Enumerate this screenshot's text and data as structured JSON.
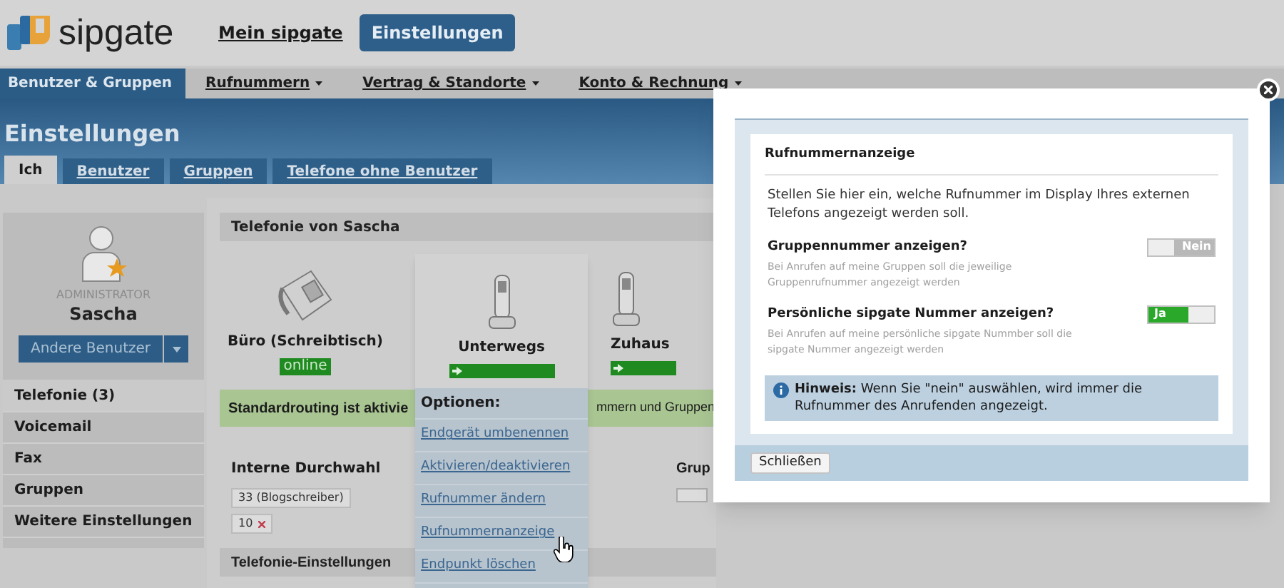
{
  "header": {
    "logo": "sipgate",
    "nav": [
      {
        "label": "Mein sipgate",
        "selected": false
      },
      {
        "label": "Einstellungen",
        "selected": true
      }
    ]
  },
  "menu": [
    {
      "label": "Benutzer & Gruppen",
      "selected": true
    },
    {
      "label": "Rufnummern",
      "selected": false
    },
    {
      "label": "Vertrag & Standorte",
      "selected": false
    },
    {
      "label": "Konto & Rechnung",
      "selected": false
    }
  ],
  "page_title": "Einstellungen",
  "tabs": [
    {
      "label": "Ich",
      "selected": true
    },
    {
      "label": "Benutzer",
      "selected": false
    },
    {
      "label": "Gruppen",
      "selected": false
    },
    {
      "label": "Telefone ohne Benutzer",
      "selected": false
    }
  ],
  "sidebar": {
    "role": "ADMINISTRATOR",
    "user": "Sascha",
    "switch_button": "Andere Benutzer",
    "items": [
      {
        "label": "Telefonie (3)",
        "selected": true
      },
      {
        "label": "Voicemail",
        "selected": false
      },
      {
        "label": "Fax",
        "selected": false
      },
      {
        "label": "Gruppen",
        "selected": false
      },
      {
        "label": "Weitere Einstellungen",
        "selected": false
      }
    ]
  },
  "telefonie": {
    "title": "Telefonie von Sascha",
    "devices": [
      {
        "name": "Büro (Schreibtisch)",
        "kind": "desk",
        "status": "online"
      },
      {
        "name": "Unterwegs",
        "kind": "mobile",
        "forwarding": true
      },
      {
        "name": "Zuhaus",
        "kind": "mobile",
        "forwarding": true
      }
    ],
    "banner": [
      "Standardrouting ist aktivie",
      "mmern und Gruppen"
    ],
    "internal": {
      "label": "Interne Durchwahl",
      "tags": [
        {
          "text": "33 (Blogschreiber)",
          "removable": false
        },
        {
          "text": "10",
          "removable": true
        }
      ]
    },
    "group_label": "Grup",
    "group_toggle_on": false,
    "settings_title": "Telefonie-Einstellungen"
  },
  "options_menu": {
    "title": "Optionen:",
    "items": [
      "Endgerät umbenennen",
      "Aktivieren/deaktivieren",
      "Rufnummer ändern",
      "Rufnummernanzeige",
      "Endpunkt löschen"
    ]
  },
  "dialog": {
    "title": "Rufnummernanzeige",
    "intro": "Stellen Sie hier ein, welche Rufnummer im Display Ihres externen Telefons angezeigt werden soll.",
    "settings": [
      {
        "label": "Gruppennummer anzeigen?",
        "hint": "Bei Anrufen auf meine Gruppen soll die jeweilige Gruppenrufnummer angezeigt werden",
        "on": false,
        "toggle_text": "Nein"
      },
      {
        "label": "Persönliche sipgate Nummer anzeigen?",
        "hint": "Bei Anrufen auf meine persönliche sipgate Nummber soll die sipgate Nummer angezeigt werden",
        "on": true,
        "toggle_text": "Ja"
      }
    ],
    "note": "**Hinweis:** Wenn Sie \"nein\" auswählen, wird immer die Rufnummer des Anrufenden angezeigt.",
    "close_button": "Schließen"
  }
}
